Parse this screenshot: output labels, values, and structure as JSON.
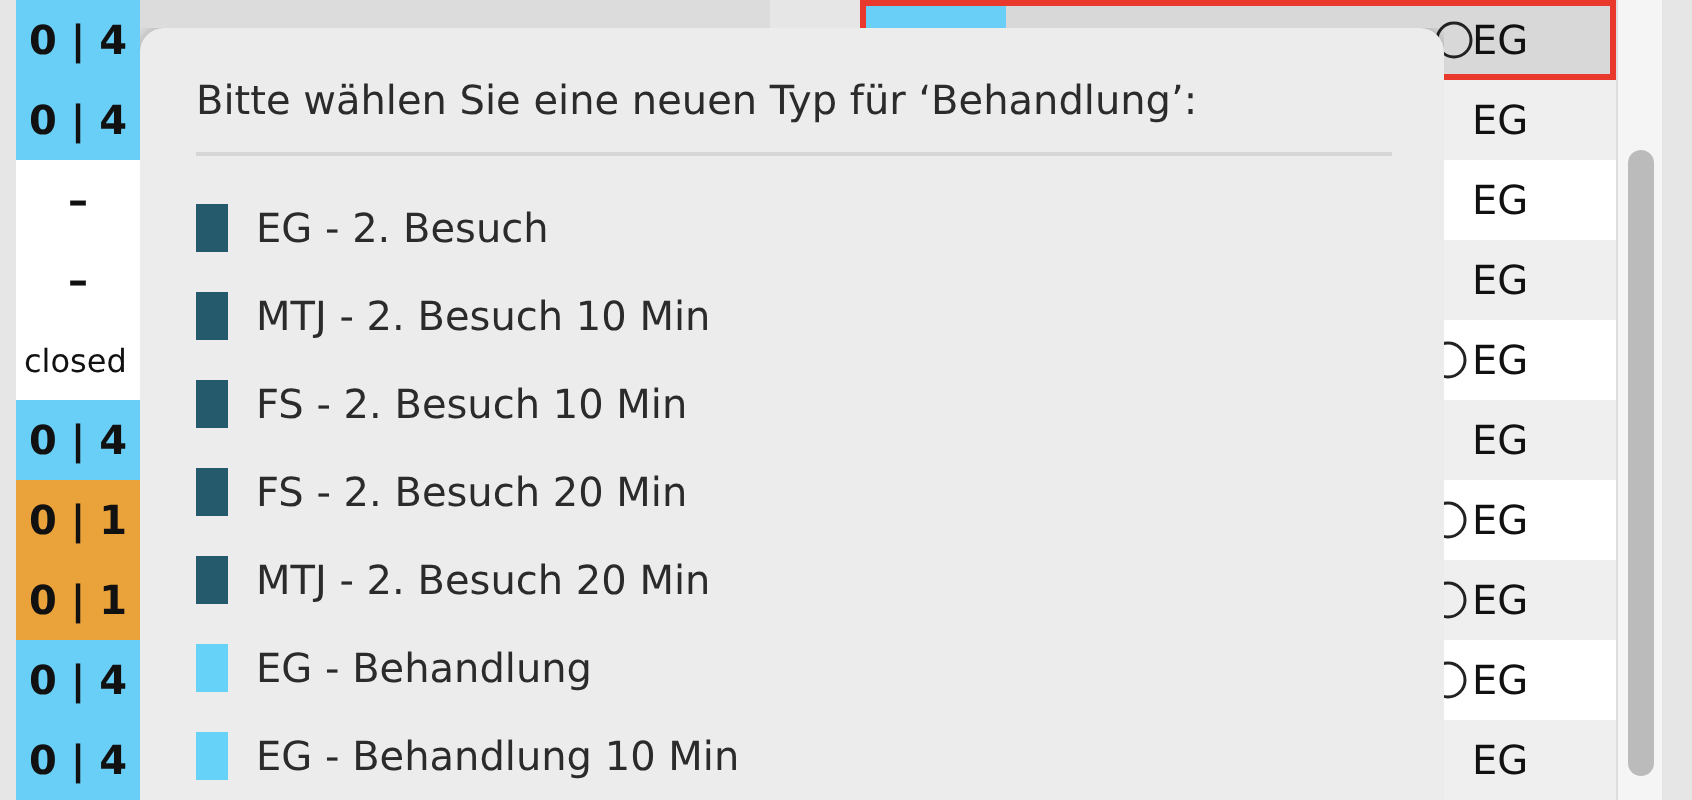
{
  "left_table": {
    "rows": [
      {
        "status": "0 | 4",
        "color": "#6acff6"
      },
      {
        "status": "0 | 4",
        "color": "#6acff6"
      },
      {
        "status": "–",
        "color": "#ffffff"
      },
      {
        "status": "–",
        "color": "#ffffff"
      },
      {
        "status": "closed",
        "color": "#ffffff"
      },
      {
        "status": "0 | 4",
        "color": "#6acff6"
      },
      {
        "status": "0 | 1",
        "color": "#eaa23b"
      },
      {
        "status": "0 | 1",
        "color": "#eaa23b"
      },
      {
        "status": "0 | 4",
        "color": "#6acff6"
      },
      {
        "status": "0 | 4",
        "color": "#6acff6"
      }
    ]
  },
  "right_table": {
    "rows": [
      {
        "selected": true,
        "info": true,
        "type": "EG"
      },
      {
        "selected": false,
        "info": false,
        "type": "EG"
      },
      {
        "selected": false,
        "info": false,
        "type": "EG"
      },
      {
        "selected": false,
        "info": false,
        "type": "EG"
      },
      {
        "selected": false,
        "info": true,
        "type": "EG"
      },
      {
        "selected": false,
        "info": false,
        "type": "EG"
      },
      {
        "selected": false,
        "info": true,
        "type": "EG"
      },
      {
        "selected": false,
        "info": true,
        "type": "EG"
      },
      {
        "selected": false,
        "info": true,
        "type": "EG"
      },
      {
        "selected": false,
        "info": false,
        "type": "EG"
      }
    ]
  },
  "popup": {
    "title": "Bitte wählen Sie eine neuen Typ für ‘Behandlung’:",
    "items": [
      {
        "label": "EG - 2. Besuch",
        "color": "#245a6b"
      },
      {
        "label": "MTJ - 2. Besuch 10 Min",
        "color": "#245a6b"
      },
      {
        "label": "FS - 2. Besuch 10 Min",
        "color": "#245a6b"
      },
      {
        "label": "FS - 2. Besuch 20 Min",
        "color": "#245a6b"
      },
      {
        "label": "MTJ - 2. Besuch 20 Min",
        "color": "#245a6b"
      },
      {
        "label": "EG - Behandlung",
        "color": "#66d2f8"
      },
      {
        "label": "EG - Behandlung 10 Min",
        "color": "#66d2f8"
      }
    ]
  }
}
